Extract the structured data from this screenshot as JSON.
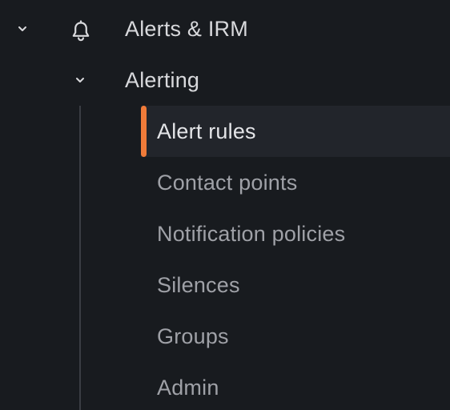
{
  "nav": {
    "section": {
      "label": "Alerts & IRM",
      "icon": "bell-icon",
      "expanded": true
    },
    "subsection": {
      "label": "Alerting",
      "expanded": true
    },
    "items": [
      {
        "label": "Alert rules",
        "active": true
      },
      {
        "label": "Contact points",
        "active": false
      },
      {
        "label": "Notification policies",
        "active": false
      },
      {
        "label": "Silences",
        "active": false
      },
      {
        "label": "Groups",
        "active": false
      },
      {
        "label": "Admin",
        "active": false
      }
    ]
  },
  "colors": {
    "background": "#181b1f",
    "active_background": "#22252b",
    "accent": "#f07b39",
    "text_primary": "#d8d9dc",
    "text_secondary": "#9fa1a7"
  }
}
